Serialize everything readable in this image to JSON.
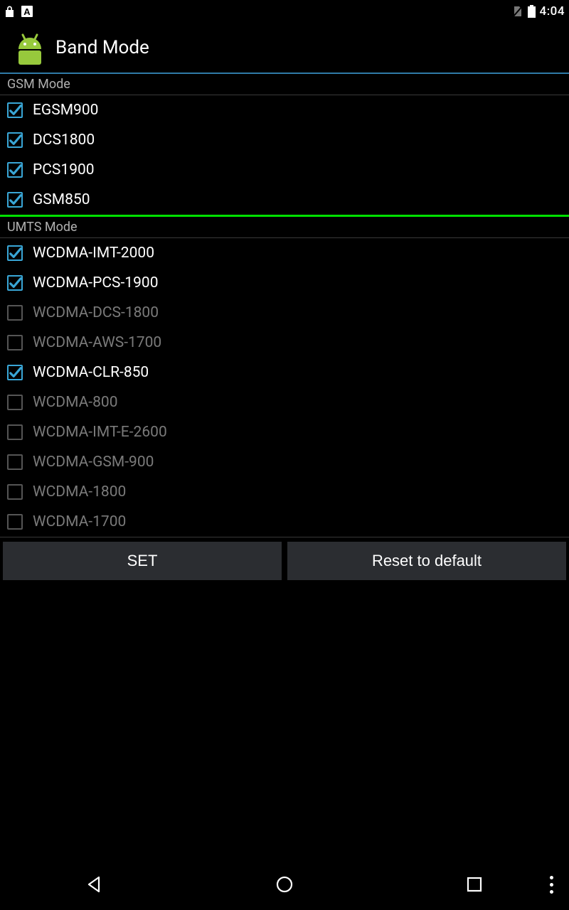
{
  "status": {
    "time": "4:04"
  },
  "app": {
    "title": "Band Mode"
  },
  "sections": {
    "gsm": {
      "header": "GSM Mode",
      "items": [
        {
          "label": "EGSM900",
          "checked": true,
          "enabled": true
        },
        {
          "label": "DCS1800",
          "checked": true,
          "enabled": true
        },
        {
          "label": "PCS1900",
          "checked": true,
          "enabled": true
        },
        {
          "label": "GSM850",
          "checked": true,
          "enabled": true
        }
      ]
    },
    "umts": {
      "header": "UMTS Mode",
      "items": [
        {
          "label": "WCDMA-IMT-2000",
          "checked": true,
          "enabled": true
        },
        {
          "label": "WCDMA-PCS-1900",
          "checked": true,
          "enabled": true
        },
        {
          "label": "WCDMA-DCS-1800",
          "checked": false,
          "enabled": false
        },
        {
          "label": "WCDMA-AWS-1700",
          "checked": false,
          "enabled": false
        },
        {
          "label": "WCDMA-CLR-850",
          "checked": true,
          "enabled": true
        },
        {
          "label": "WCDMA-800",
          "checked": false,
          "enabled": false
        },
        {
          "label": "WCDMA-IMT-E-2600",
          "checked": false,
          "enabled": false
        },
        {
          "label": "WCDMA-GSM-900",
          "checked": false,
          "enabled": false
        },
        {
          "label": "WCDMA-1800",
          "checked": false,
          "enabled": false
        },
        {
          "label": "WCDMA-1700",
          "checked": false,
          "enabled": false
        }
      ]
    }
  },
  "actions": {
    "set": "SET",
    "reset": "Reset to default"
  }
}
